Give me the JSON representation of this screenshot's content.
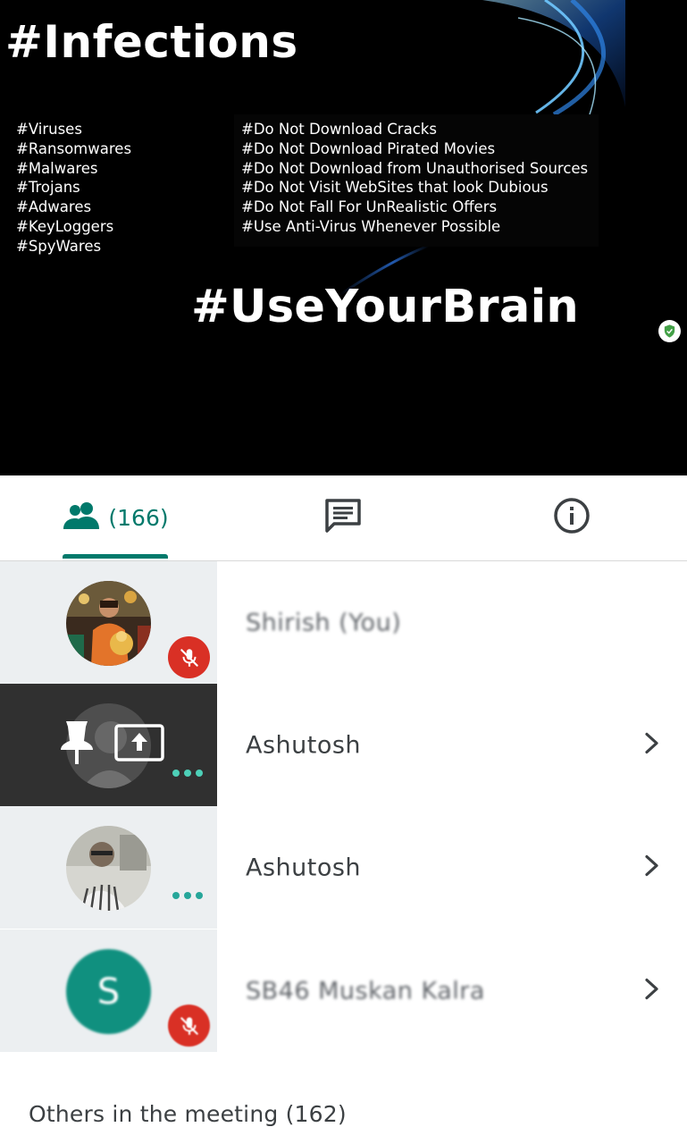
{
  "presentation": {
    "title": "#Infections",
    "threats": [
      "#Viruses",
      "#Ransomwares",
      "#Malwares",
      "#Trojans",
      "#Adwares",
      "#KeyLoggers",
      "#SpyWares"
    ],
    "tips": [
      "#Do Not Download Cracks",
      "#Do Not Download Pirated Movies",
      "#Do Not Download from Unauthorised Sources",
      "#Do Not Visit WebSites that look Dubious",
      "#Do Not Fall For UnRealistic Offers",
      "#Use Anti-Virus Whenever Possible"
    ],
    "footer": "#UseYourBrain"
  },
  "tabs": {
    "people_count": "(166)",
    "active": "people"
  },
  "participants": [
    {
      "name": "Shirish (You)",
      "muted": true,
      "avatar": "photo"
    },
    {
      "name": "Ashutosh",
      "presenting": true,
      "avatar": "photo"
    },
    {
      "name": "Ashutosh",
      "avatar": "photo"
    },
    {
      "name": "SB46 Muskan Kalra",
      "muted": true,
      "initial": "S"
    }
  ],
  "others_label": "Others in the meeting (162)",
  "colors": {
    "accent": "#00796b",
    "mute": "#d93025",
    "avatar_teal": "#10907f"
  }
}
